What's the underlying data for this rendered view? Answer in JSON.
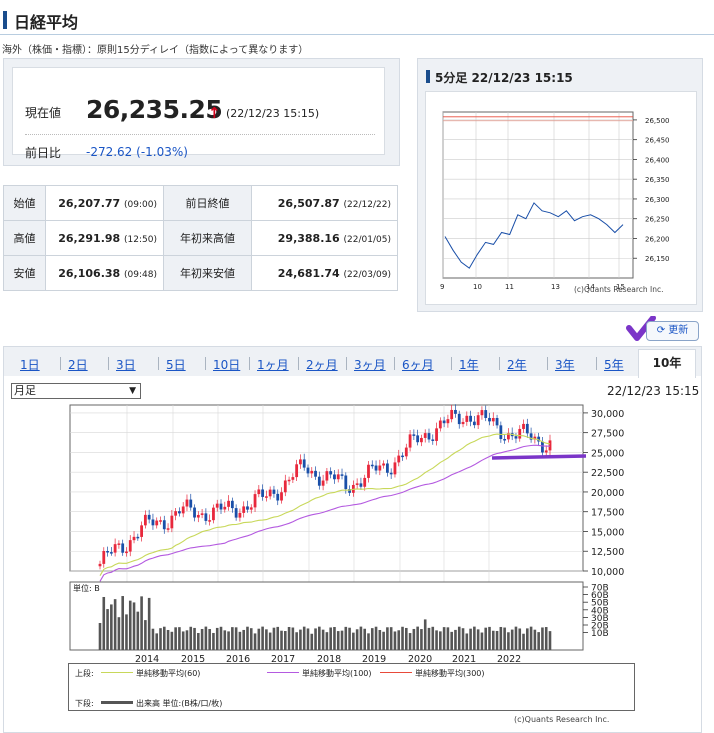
{
  "page": {
    "title": "日経平均",
    "note": "海外（株価・指標）：原則15分ディレイ（指数によって異なります）"
  },
  "price": {
    "label_now": "現在値",
    "value": "26,235.25",
    "arrow": "↑",
    "time": "(22/12/23 15:15)",
    "label_prev": "前日比",
    "change": "-272.62 (-1.03%)"
  },
  "ohlc": [
    {
      "label": "始値",
      "value": "26,207.77",
      "time": "(09:00)",
      "label2": "前日終値",
      "value2": "26,507.87",
      "time2": "(22/12/22)"
    },
    {
      "label": "高値",
      "value": "26,291.98",
      "time": "(12:50)",
      "label2": "年初来高値",
      "value2": "29,388.16",
      "time2": "(22/01/05)"
    },
    {
      "label": "安値",
      "value": "26,106.38",
      "time": "(09:48)",
      "label2": "年初来安値",
      "value2": "24,681.74",
      "time2": "(22/03/09)"
    }
  ],
  "five_min": {
    "title": "5分足 22/12/23 15:15",
    "y_ticks": [
      "26,500",
      "26,450",
      "26,400",
      "26,350",
      "26,300",
      "26,250",
      "26,200",
      "26,150"
    ],
    "x_ticks": [
      "9",
      "10",
      "11",
      "13",
      "14",
      "15"
    ],
    "copyright": "(c)Quants Research Inc."
  },
  "refresh_label": "更新",
  "tabs": [
    "1日",
    "2日",
    "3日",
    "5日",
    "10日",
    "1ヶ月",
    "2ヶ月",
    "3ヶ月",
    "6ヶ月",
    "1年",
    "2年",
    "3年",
    "5年"
  ],
  "active_tab": "10年",
  "period_select": "月足",
  "chart_time": "22/12/23 15:15",
  "main_chart": {
    "y_ticks": [
      "30,000",
      "27,500",
      "25,000",
      "22,500",
      "20,000",
      "17,500",
      "15,000",
      "12,500",
      "10,000"
    ],
    "vol_ticks": [
      "70B",
      "60B",
      "50B",
      "40B",
      "30B",
      "20B",
      "10B"
    ],
    "vol_unit": "単位: B",
    "years": [
      "2014",
      "2015",
      "2016",
      "2017",
      "2018",
      "2019",
      "2020",
      "2021",
      "2022"
    ]
  },
  "legend": {
    "upper_label": "上段:",
    "ma60": "単純移動平均(60)",
    "ma100": "単純移動平均(100)",
    "ma300": "単純移動平均(300)",
    "lower_label": "下段:",
    "volume": "出来高 単位:(B株/口/枚)"
  },
  "copyright_main": "(c)Quants Research Inc.",
  "colors": {
    "up": "#e8283c",
    "down": "#1a4fa8",
    "ma60": "#c8d85a",
    "ma100": "#b45ae0",
    "ma300": "#e84a3a",
    "accent": "#1a4d8c"
  },
  "chart_data": [
    {
      "type": "line",
      "title": "5分足 22/12/23 15:15",
      "x": [
        "9:00",
        "9:15",
        "9:30",
        "9:45",
        "10:00",
        "10:15",
        "10:30",
        "10:45",
        "11:00",
        "11:15",
        "11:30",
        "12:30",
        "12:45",
        "13:00",
        "13:15",
        "13:30",
        "13:45",
        "14:00",
        "14:15",
        "14:30",
        "14:45",
        "15:00",
        "15:15"
      ],
      "values": [
        26205,
        26170,
        26140,
        26125,
        26160,
        26190,
        26185,
        26215,
        26210,
        26260,
        26250,
        26290,
        26270,
        26265,
        26255,
        26270,
        26245,
        26255,
        26260,
        26250,
        26235,
        26215,
        26235
      ],
      "ylim": [
        26100,
        26520
      ],
      "reference_line": 26507.87
    },
    {
      "type": "line",
      "title": "",
      "x": [
        "2013-01",
        "2014-01",
        "2015-01",
        "2016-01",
        "2017-01",
        "2018-01",
        "2019-01",
        "2020-01",
        "2021-01",
        "2021-03",
        "2022-01",
        "2022-12"
      ],
      "values": [
        10900,
        15300,
        17500,
        17500,
        19100,
        23100,
        20800,
        23200,
        27600,
        29900,
        27500,
        26235
      ],
      "ma60_end": 24800,
      "ma100_end": 22300,
      "ylim": [
        10000,
        31000
      ]
    }
  ]
}
